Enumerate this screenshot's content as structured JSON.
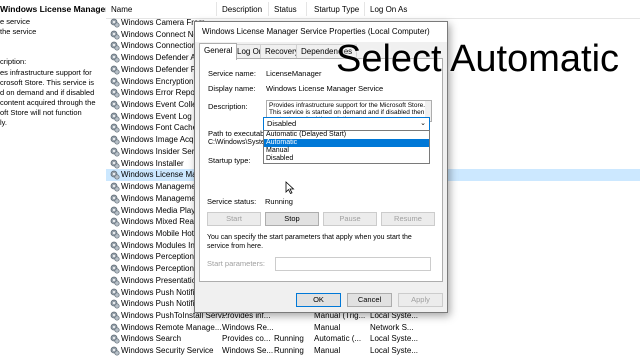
{
  "left_pane": {
    "title": "Windows License Manager Service",
    "lines": [
      "e service",
      "the service",
      "",
      "cription:",
      "es infrastructure support for",
      "crosoft Store. This service is",
      "d on demand and if disabled",
      "content acquired through the",
      "oft Store will not function",
      "ly."
    ]
  },
  "columns": {
    "name": "Name",
    "description": "Description",
    "status": "Status",
    "startup_type": "Startup Type",
    "log_on_as": "Log On As"
  },
  "services": [
    {
      "name": "Windows Camera Fram...",
      "description": "",
      "status": "",
      "startup": "",
      "logon": ""
    },
    {
      "name": "Windows Connect Now...",
      "description": "",
      "status": "",
      "startup": "",
      "logon": ""
    },
    {
      "name": "Windows Connection ...",
      "description": "",
      "status": "",
      "startup": "",
      "logon": ""
    },
    {
      "name": "Windows Defender Ad...",
      "description": "",
      "status": "",
      "startup": "",
      "logon": ""
    },
    {
      "name": "Windows Defender Fir...",
      "description": "",
      "status": "",
      "startup": "",
      "logon": ""
    },
    {
      "name": "Windows Encryption P...",
      "description": "",
      "status": "",
      "startup": "",
      "logon": ""
    },
    {
      "name": "Windows Error Report...",
      "description": "",
      "status": "",
      "startup": "",
      "logon": ""
    },
    {
      "name": "Windows Event Collect...",
      "description": "",
      "status": "",
      "startup": "",
      "logon": ""
    },
    {
      "name": "Windows Event Log",
      "description": "",
      "status": "",
      "startup": "",
      "logon": ""
    },
    {
      "name": "Windows Font Cache S...",
      "description": "",
      "status": "",
      "startup": "",
      "logon": ""
    },
    {
      "name": "Windows Image Acqui...",
      "description": "",
      "status": "",
      "startup": "",
      "logon": ""
    },
    {
      "name": "Windows Insider Servi...",
      "description": "",
      "status": "",
      "startup": "",
      "logon": ""
    },
    {
      "name": "Windows Installer",
      "description": "",
      "status": "",
      "startup": "",
      "logon": ""
    },
    {
      "name": "Windows License Mana...",
      "description": "",
      "status": "",
      "startup": "",
      "logon": "",
      "selected": true
    },
    {
      "name": "Windows Management...",
      "description": "",
      "status": "",
      "startup": "",
      "logon": ""
    },
    {
      "name": "Windows Management...",
      "description": "",
      "status": "",
      "startup": "",
      "logon": ""
    },
    {
      "name": "Windows Media Player...",
      "description": "",
      "status": "",
      "startup": "",
      "logon": ""
    },
    {
      "name": "Windows Mixed Reality...",
      "description": "",
      "status": "",
      "startup": "",
      "logon": ""
    },
    {
      "name": "Windows Mobile Hotsp...",
      "description": "",
      "status": "",
      "startup": "",
      "logon": ""
    },
    {
      "name": "Windows Modules Insta...",
      "description": "",
      "status": "",
      "startup": "",
      "logon": ""
    },
    {
      "name": "Windows Perception S...",
      "description": "",
      "status": "",
      "startup": "",
      "logon": ""
    },
    {
      "name": "Windows Perception S...",
      "description": "",
      "status": "",
      "startup": "",
      "logon": ""
    },
    {
      "name": "Windows Presentation...",
      "description": "",
      "status": "",
      "startup": "",
      "logon": ""
    },
    {
      "name": "Windows Push Notifica...",
      "description": "",
      "status": "",
      "startup": "",
      "logon": ""
    },
    {
      "name": "Windows Push Notifica...",
      "description": "",
      "status": "",
      "startup": "",
      "logon": ""
    },
    {
      "name": "Windows PushToInstall Serv...",
      "description": "Provides inf...",
      "status": "",
      "startup": "Manual (Trig...",
      "logon": "Local Syste..."
    },
    {
      "name": "Windows Remote Manage...",
      "description": "Windows Re...",
      "status": "",
      "startup": "Manual",
      "logon": "Network S..."
    },
    {
      "name": "Windows Search",
      "description": "Provides co...",
      "status": "Running",
      "startup": "Automatic (...",
      "logon": "Local Syste..."
    },
    {
      "name": "Windows Security Service",
      "description": "Windows Se...",
      "status": "Running",
      "startup": "Manual",
      "logon": "Local Syste..."
    }
  ],
  "dialog": {
    "title": "Windows License Manager Service Properties (Local Computer)",
    "tabs": [
      "General",
      "Log On",
      "Recovery",
      "Dependencies"
    ],
    "service_name_label": "Service name:",
    "service_name": "LicenseManager",
    "display_name_label": "Display name:",
    "display_name": "Windows License Manager Service",
    "description_label": "Description:",
    "description": "Provides infrastructure support for the Microsoft Store. This service is started on demand and if disabled then content acquired through the",
    "path_label": "Path to executable:",
    "path": "C:\\Windows\\System32\\svchost.exe -k LocalService -p",
    "startup_type_label": "Startup type:",
    "startup_type_value": "Disabled",
    "startup_options": [
      "Automatic (Delayed Start)",
      "Automatic",
      "Manual",
      "Disabled"
    ],
    "highlighted_option": "Automatic",
    "service_status_label": "Service status:",
    "service_status": "Running",
    "start_btn": "Start",
    "stop_btn": "Stop",
    "pause_btn": "Pause",
    "resume_btn": "Resume",
    "hint": "You can specify the start parameters that apply when you start the service from here.",
    "start_params_label": "Start parameters:",
    "ok_btn": "OK",
    "cancel_btn": "Cancel",
    "apply_btn": "Apply"
  },
  "caption": "Select Automatic",
  "colors": {
    "selection": "#cce8ff",
    "dropdown_highlight": "#0078d7",
    "dialog_bg": "#f0f0f0"
  }
}
